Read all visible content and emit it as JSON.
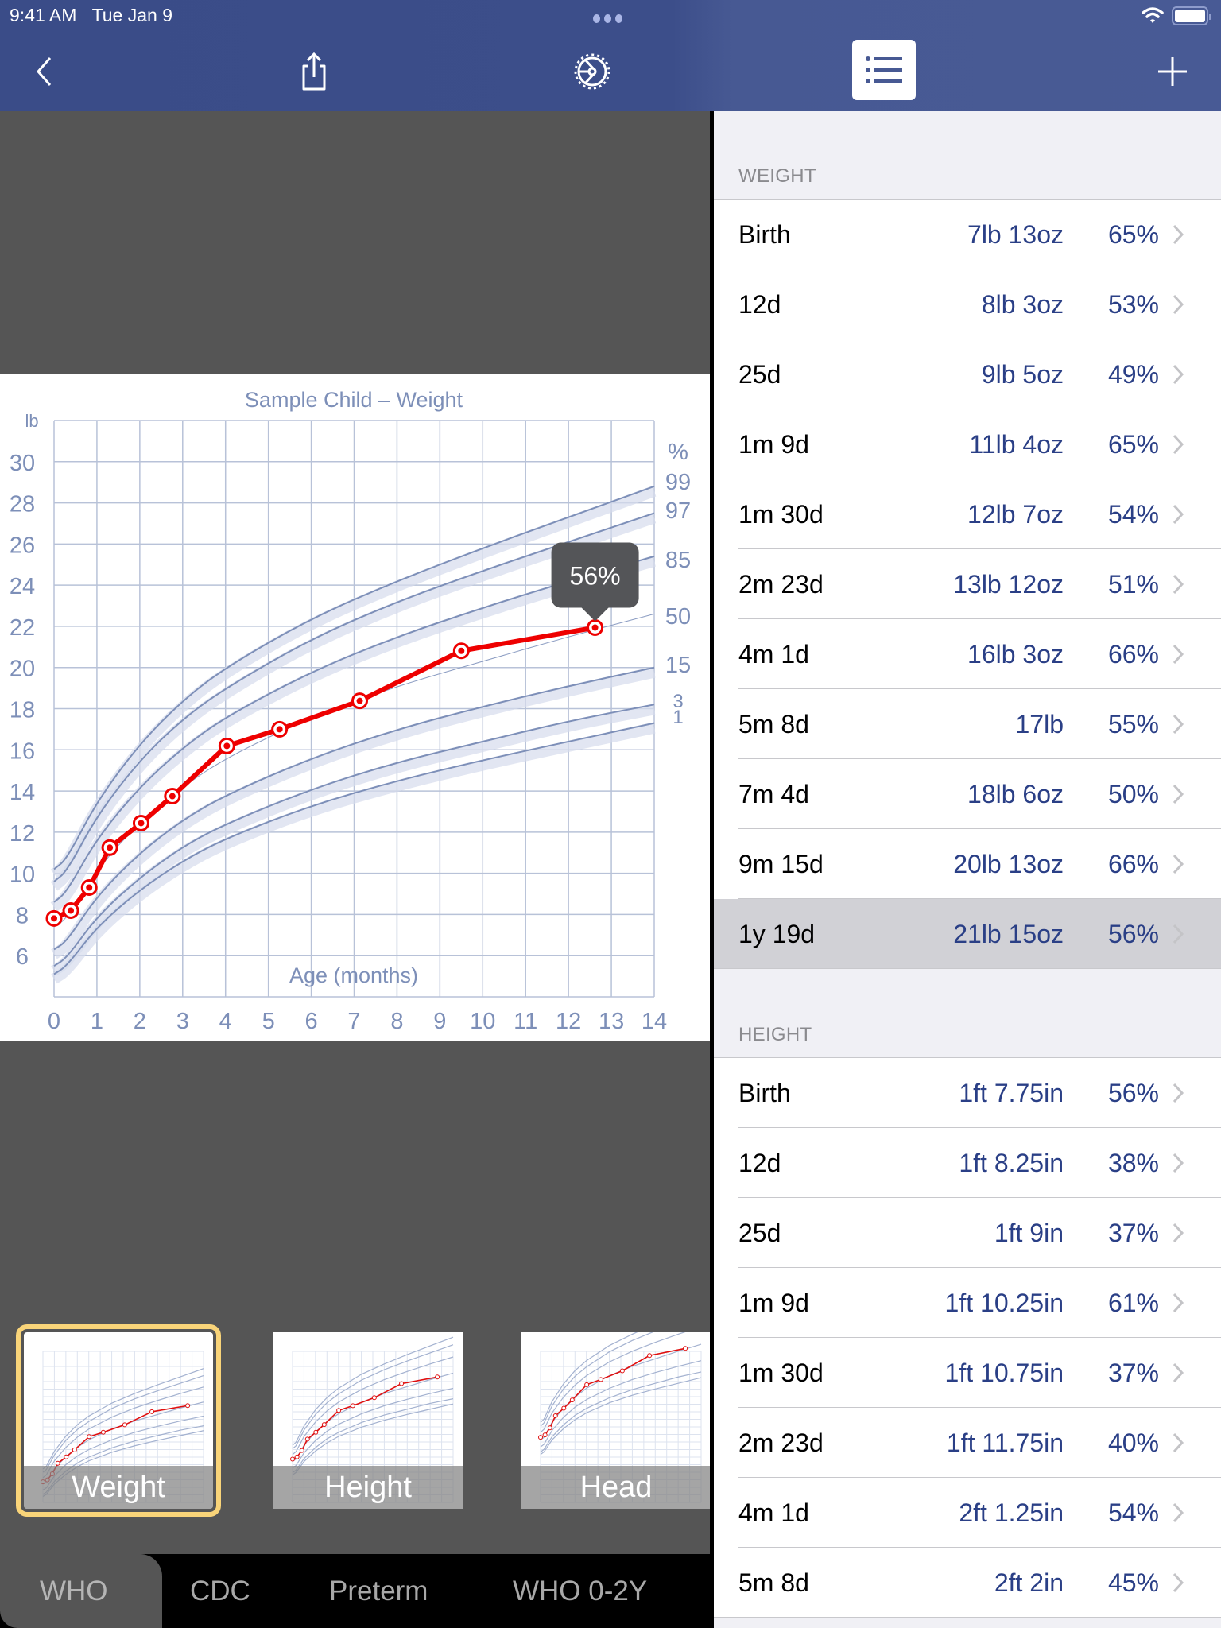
{
  "status_bar": {
    "time": "9:41 AM",
    "date": "Tue Jan 9"
  },
  "nav": {
    "back_icon": "chevron-left-icon",
    "share_icon": "share-icon",
    "settings_icon": "gear-icon",
    "list_icon": "list-icon",
    "add_icon": "plus-icon"
  },
  "colors": {
    "nav_bg": "#3c4e8a",
    "accent_value": "#2a3f86",
    "data_line": "#ee0000",
    "percentile_curve": "#7d8fb8",
    "grid": "#b8c2d8",
    "selected_thumb_border": "#f9d479",
    "selected_row": "#d1d1d6"
  },
  "chart_data": {
    "type": "line",
    "title": "Sample Child – Weight",
    "xlabel": "Age (months)",
    "ylabel": "lb",
    "right_axis_label": "%",
    "xlim": [
      0,
      14
    ],
    "ylim": [
      4,
      32
    ],
    "x_ticks": [
      "0",
      "1",
      "2",
      "3",
      "4",
      "5",
      "6",
      "7",
      "8",
      "9",
      "10",
      "11",
      "12",
      "13",
      "14"
    ],
    "y_ticks": [
      "30",
      "28",
      "26",
      "24",
      "22",
      "20",
      "18",
      "16",
      "14",
      "12",
      "10",
      "8",
      "6"
    ],
    "y_tick_values": [
      30,
      28,
      26,
      24,
      22,
      20,
      18,
      16,
      14,
      12,
      10,
      8,
      6
    ],
    "grid": true,
    "series": [
      {
        "name": "Sample Child",
        "x": [
          0,
          0.39,
          0.82,
          1.3,
          2.03,
          2.76,
          4.03,
          5.26,
          7.13,
          9.5,
          12.62
        ],
        "y": [
          7.81,
          8.19,
          9.31,
          11.25,
          12.44,
          13.75,
          16.19,
          17.0,
          18.38,
          20.81,
          21.94
        ]
      }
    ],
    "percentile_curves": [
      {
        "label": "99",
        "x": [
          0,
          0.3,
          1,
          2,
          3,
          4,
          6,
          8,
          10,
          12,
          14
        ],
        "y": [
          10.2,
          10.7,
          13.5,
          16.3,
          18.4,
          20.0,
          22.4,
          24.2,
          25.8,
          27.3,
          28.8
        ]
      },
      {
        "label": "97",
        "x": [
          0,
          0.3,
          1,
          2,
          3,
          4,
          6,
          8,
          10,
          12,
          14
        ],
        "y": [
          9.6,
          10.1,
          12.8,
          15.5,
          17.5,
          19.0,
          21.4,
          23.2,
          24.7,
          26.1,
          27.5
        ]
      },
      {
        "label": "85",
        "x": [
          0,
          0.3,
          1,
          2,
          3,
          4,
          6,
          8,
          10,
          12,
          14
        ],
        "y": [
          8.6,
          9.1,
          11.7,
          14.2,
          16.1,
          17.6,
          19.8,
          21.5,
          22.9,
          24.2,
          25.4
        ]
      },
      {
        "label": "50",
        "x": [
          0,
          0.3,
          1,
          2,
          3,
          4,
          6,
          8,
          10,
          12,
          14
        ],
        "y": [
          7.4,
          7.8,
          10.2,
          12.5,
          14.2,
          15.6,
          17.6,
          19.1,
          20.3,
          21.5,
          22.6
        ]
      },
      {
        "label": "15",
        "x": [
          0,
          0.3,
          1,
          2,
          3,
          4,
          6,
          8,
          10,
          12,
          14
        ],
        "y": [
          6.3,
          6.7,
          8.9,
          11.0,
          12.6,
          13.8,
          15.6,
          17.0,
          18.1,
          19.1,
          20.0
        ]
      },
      {
        "label": "3",
        "x": [
          0,
          0.3,
          1,
          2,
          3,
          4,
          6,
          8,
          10,
          12,
          14
        ],
        "y": [
          5.5,
          5.9,
          7.9,
          9.8,
          11.3,
          12.4,
          14.1,
          15.4,
          16.4,
          17.4,
          18.2
        ]
      },
      {
        "label": "1",
        "x": [
          0,
          0.3,
          1,
          2,
          3,
          4,
          6,
          8,
          10,
          12,
          14
        ],
        "y": [
          5.1,
          5.5,
          7.4,
          9.2,
          10.6,
          11.7,
          13.3,
          14.5,
          15.5,
          16.4,
          17.3
        ]
      }
    ],
    "callout": {
      "text": "56%",
      "x": 12.62,
      "y": 21.94
    }
  },
  "thumbnails": [
    {
      "label": "Weight",
      "selected": true
    },
    {
      "label": "Height",
      "selected": false
    },
    {
      "label": "Head",
      "selected": false
    }
  ],
  "tabs": [
    {
      "label": "WHO",
      "active": true
    },
    {
      "label": "CDC",
      "active": false
    },
    {
      "label": "Preterm",
      "active": false
    },
    {
      "label": "WHO 0-2Y",
      "active": false
    }
  ],
  "list": {
    "sections": [
      {
        "title": "WEIGHT",
        "rows": [
          {
            "age": "Birth",
            "value": "7lb 13oz",
            "pct": "65%"
          },
          {
            "age": "12d",
            "value": "8lb 3oz",
            "pct": "53%"
          },
          {
            "age": "25d",
            "value": "9lb 5oz",
            "pct": "49%"
          },
          {
            "age": "1m 9d",
            "value": "11lb 4oz",
            "pct": "65%"
          },
          {
            "age": "1m 30d",
            "value": "12lb 7oz",
            "pct": "54%"
          },
          {
            "age": "2m 23d",
            "value": "13lb 12oz",
            "pct": "51%"
          },
          {
            "age": "4m 1d",
            "value": "16lb 3oz",
            "pct": "66%"
          },
          {
            "age": "5m 8d",
            "value": "17lb",
            "pct": "55%"
          },
          {
            "age": "7m 4d",
            "value": "18lb 6oz",
            "pct": "50%"
          },
          {
            "age": "9m 15d",
            "value": "20lb 13oz",
            "pct": "66%"
          },
          {
            "age": "1y 19d",
            "value": "21lb 15oz",
            "pct": "56%",
            "selected": true
          }
        ]
      },
      {
        "title": "HEIGHT",
        "rows": [
          {
            "age": "Birth",
            "value": "1ft 7.75in",
            "pct": "56%"
          },
          {
            "age": "12d",
            "value": "1ft 8.25in",
            "pct": "38%"
          },
          {
            "age": "25d",
            "value": "1ft 9in",
            "pct": "37%"
          },
          {
            "age": "1m 9d",
            "value": "1ft 10.25in",
            "pct": "61%"
          },
          {
            "age": "1m 30d",
            "value": "1ft 10.75in",
            "pct": "37%"
          },
          {
            "age": "2m 23d",
            "value": "1ft 11.75in",
            "pct": "40%"
          },
          {
            "age": "4m 1d",
            "value": "2ft 1.25in",
            "pct": "54%"
          },
          {
            "age": "5m 8d",
            "value": "2ft 2in",
            "pct": "45%"
          }
        ]
      }
    ]
  }
}
